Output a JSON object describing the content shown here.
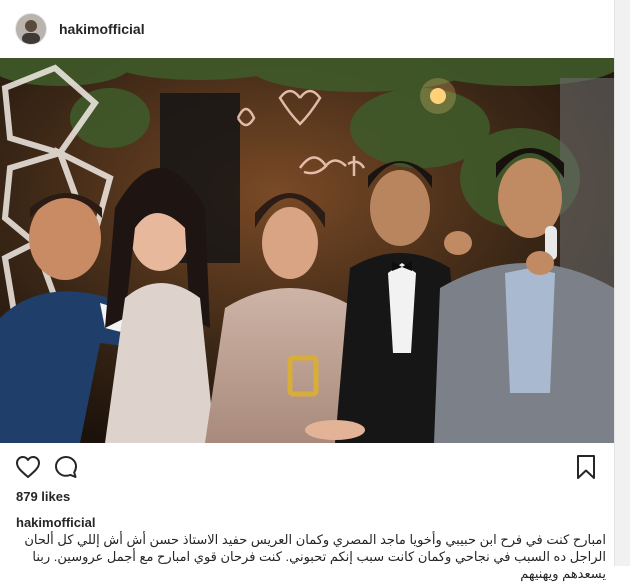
{
  "post": {
    "username": "hakimofficial",
    "likes": "879 likes",
    "caption_user": "hakimofficial",
    "caption_text": "امبارح كنت في فرح ابن حبيبي وأخويا ماجد المصري وكمان العريس حفيد الاستاذ حسن أش أش إللي كل ألحان الراجل ده السبب في نجاحي وكمان كانت سبب إنكم تحبوني. كنت فرحان قوي امبارح مع أجمل عروسين. ربنا يسعدهم ويهنيهم"
  },
  "icons": {
    "avatar": "profile-avatar",
    "like": "heart-icon",
    "comment": "comment-bubble-icon",
    "save": "bookmark-icon"
  },
  "colors": {
    "text": "#262626",
    "border": "#dbdbdb",
    "photo_background": "#2a1c12",
    "neon_sign": "#f2c9b8"
  }
}
